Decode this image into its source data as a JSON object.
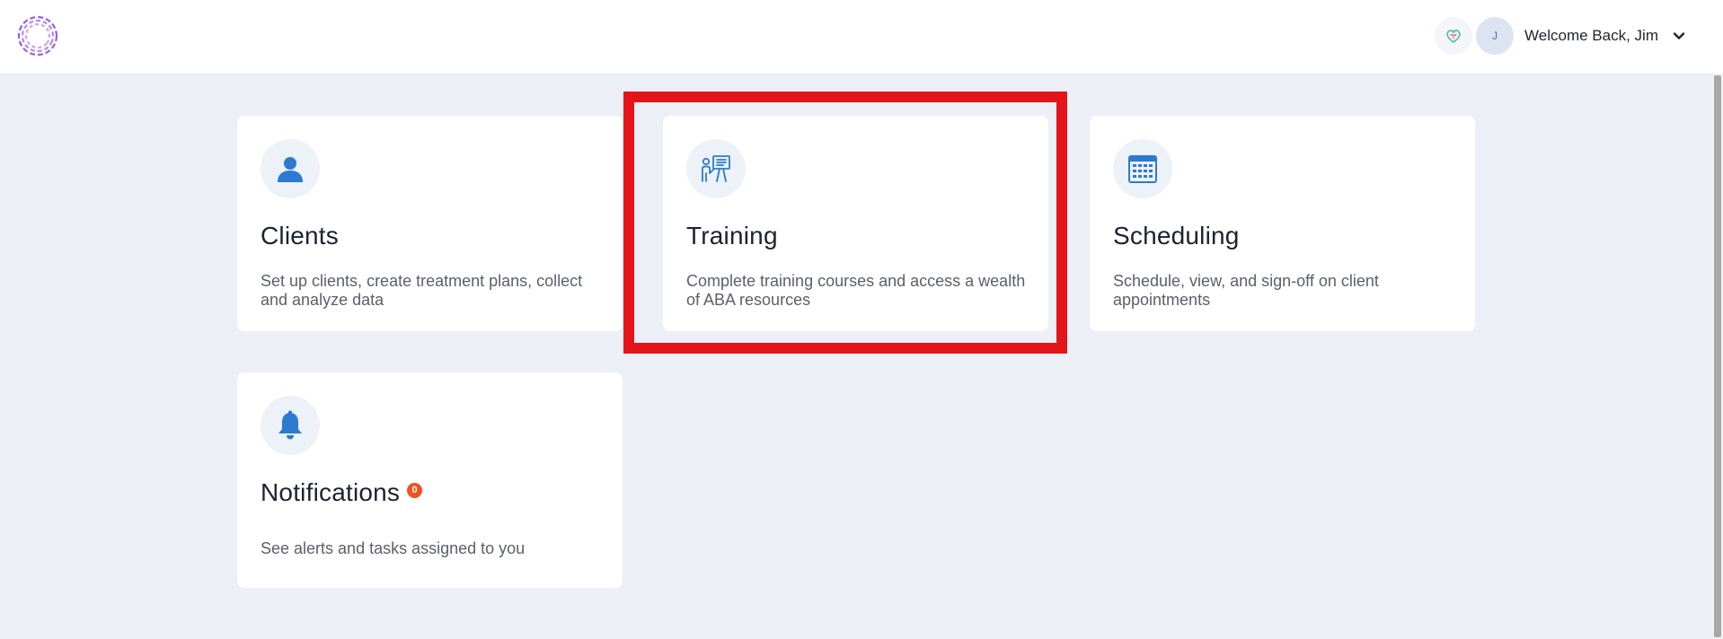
{
  "header": {
    "avatar_initial": "J",
    "welcome_text": "Welcome Back, Jim"
  },
  "cards": {
    "clients": {
      "title": "Clients",
      "description": "Set up clients, create treatment plans, collect and analyze data"
    },
    "training": {
      "title": "Training",
      "description": "Complete training courses and access a wealth of ABA resources"
    },
    "scheduling": {
      "title": "Scheduling",
      "description": "Schedule, view, and sign-off on client appointments"
    },
    "notifications": {
      "title": "Notifications",
      "badge_count": "0",
      "description": "See alerts and tasks assigned to you"
    }
  },
  "colors": {
    "accent": "#2C7BD1",
    "background": "#ECEFF6",
    "highlight": "#E4141B",
    "badge": "#F2501F",
    "logo": "#9B5DE5"
  }
}
